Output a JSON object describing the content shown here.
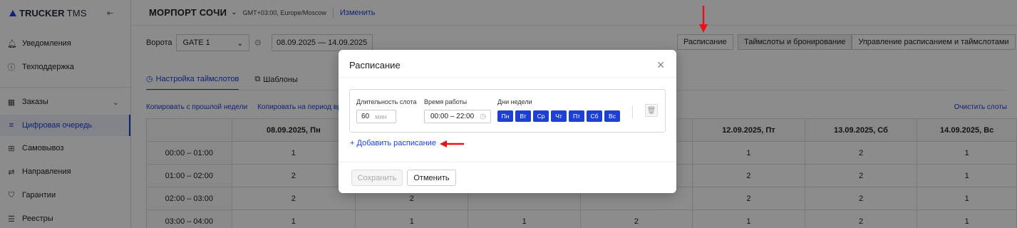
{
  "app": {
    "brand": "TRUCKER",
    "brand_suffix": "TMS"
  },
  "sidebar": {
    "items": [
      {
        "label": "Уведомления",
        "icon": "bell-icon"
      },
      {
        "label": "Техподдержка",
        "icon": "help-circle-icon"
      },
      {
        "label": "Заказы",
        "icon": "calendar-icon"
      },
      {
        "label": "Цифровая очередь",
        "icon": "queue-icon",
        "active": true
      },
      {
        "label": "Самовывоз",
        "icon": "pickup-icon"
      },
      {
        "label": "Направления",
        "icon": "directions-icon"
      },
      {
        "label": "Гарантии",
        "icon": "shield-icon"
      },
      {
        "label": "Реестры",
        "icon": "list-icon"
      }
    ]
  },
  "header": {
    "port": "МОРПОРТ СОЧИ",
    "timezone": "GMT+03:00, Europe/Moscow",
    "change_link": "Изменить"
  },
  "toolbar": {
    "gate_label": "Ворота",
    "gate_value": "GATE 1",
    "date_range": "08.09.2025 — 14.09.2025",
    "schedule_button": "Расписание",
    "seg_timeslots": "Таймслоты и бронирование",
    "seg_manage": "Управление расписанием и таймслотами"
  },
  "tabs": {
    "settings": "Настройка таймслотов",
    "templates": "Шаблоны"
  },
  "actions": {
    "copy_prev": "Копировать с прошлой недели",
    "copy_period": "Копировать на период вр",
    "clear": "Очистить слоты"
  },
  "table": {
    "columns": [
      "08.09.2025, Пн",
      "",
      "",
      "",
      "12.09.2025, Пт",
      "13.09.2025, Сб",
      "14.09.2025, Вс"
    ],
    "rows": [
      {
        "time": "00:00 – 01:00",
        "cells": [
          "1",
          "",
          "",
          "",
          "1",
          "2",
          "1"
        ]
      },
      {
        "time": "01:00 – 02:00",
        "cells": [
          "2",
          "",
          "",
          "",
          "2",
          "2",
          "1"
        ]
      },
      {
        "time": "02:00 – 03:00",
        "cells": [
          "2",
          "2",
          "",
          "",
          "2",
          "2",
          "1"
        ]
      },
      {
        "time": "03:00 – 04:00",
        "cells": [
          "1",
          "1",
          "1",
          "2",
          "1",
          "2",
          "1"
        ]
      }
    ]
  },
  "modal": {
    "title": "Расписание",
    "slot_duration_label": "Длительность слота",
    "slot_duration_value": "60",
    "slot_duration_unit": "мин",
    "work_time_label": "Время работы",
    "work_time_value": "00:00 – 22:00",
    "weekdays_label": "Дни недели",
    "weekdays": [
      "Пн",
      "Вт",
      "Ср",
      "Чт",
      "Пт",
      "Сб",
      "Вс"
    ],
    "add_schedule": "+ Добавить расписание",
    "save": "Сохранить",
    "cancel": "Отменить"
  },
  "colors": {
    "accent": "#1d3fd6",
    "annotation_arrow": "#e8121a"
  }
}
